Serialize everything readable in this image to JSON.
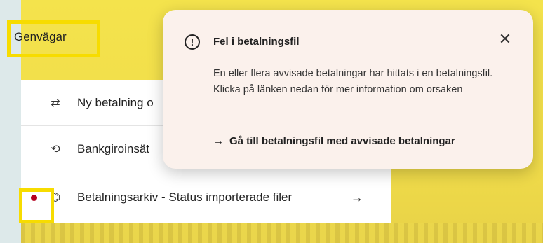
{
  "shortcuts": {
    "title": "Genvägar",
    "items": [
      {
        "label": "Ny betalning o",
        "icon": "transfer-arrows-icon",
        "glyph": "⇄"
      },
      {
        "label": "Bankgiroinsät",
        "icon": "refresh-swirl-icon",
        "glyph": "⟲"
      },
      {
        "label": "Betalningsarkiv - Status importerade filer",
        "icon": "archive-icon",
        "glyph": "⌬",
        "arrow": "→"
      }
    ]
  },
  "popup": {
    "icon": "!",
    "title": "Fel i betalningsfil",
    "close_glyph": "✕",
    "body": "En eller flera avvisade betalningar har hittats i en betalningsfil. Klicka på länken nedan för mer information om orsaken",
    "link_arrow": "→",
    "link_label": "Gå till betalningsfil med avvisade betalningar"
  },
  "colors": {
    "highlight": "#f7dc00",
    "alert_dot": "#b4001e",
    "popup_bg": "#fbf1ec",
    "background": "#f4e34c"
  }
}
